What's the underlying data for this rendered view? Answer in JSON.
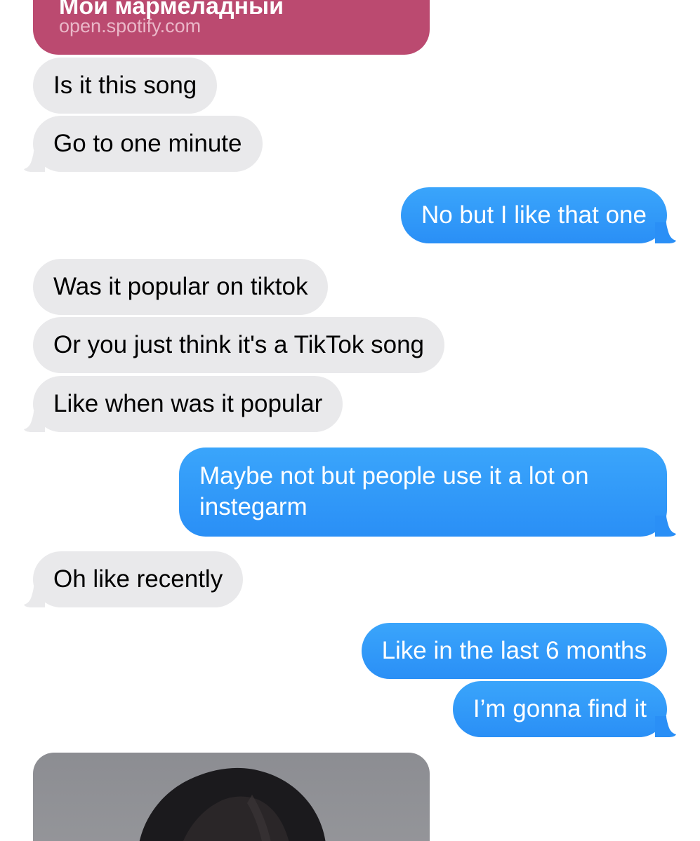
{
  "link_preview": {
    "title": "Мой мармеладный",
    "domain": "open.spotify.com"
  },
  "messages": [
    {
      "direction": "in",
      "text": "Is it this song"
    },
    {
      "direction": "in",
      "text": "Go to one minute"
    },
    {
      "direction": "out",
      "text": "No but I like that one"
    },
    {
      "direction": "in",
      "text": "Was it popular on tiktok"
    },
    {
      "direction": "in",
      "text": "Or you just think it's a TikTok song"
    },
    {
      "direction": "in",
      "text": "Like when was it popular"
    },
    {
      "direction": "out",
      "text": "Maybe not but people use it a lot on instegarm"
    },
    {
      "direction": "in",
      "text": "Oh like recently"
    },
    {
      "direction": "out",
      "text": "Like in the last 6 months"
    },
    {
      "direction": "out",
      "text": "I’m gonna find it"
    }
  ],
  "image_message": {
    "icon": "photo-attachment"
  },
  "colors": {
    "incoming_bubble": "#e9e9eb",
    "outgoing_bubble": "#2a8ff6",
    "link_card": "#bb4a70"
  }
}
